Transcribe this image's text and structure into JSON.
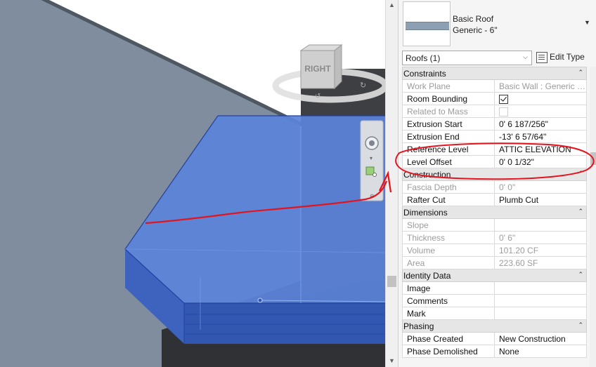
{
  "viewcube": {
    "face_label": "RIGHT"
  },
  "type_selector": {
    "family_name": "Basic Roof",
    "type_name": "Generic - 6\"",
    "dropdown_icon": "triangle-down-icon"
  },
  "instance_filter": {
    "value": "Roofs (1)",
    "edit_type_label": "Edit Type"
  },
  "properties": [
    {
      "group": "Constraints",
      "rows": [
        {
          "name": "Work Plane",
          "value": "Basic Wall : Generic - ...",
          "readonly": true
        },
        {
          "name": "Room Bounding",
          "value": "",
          "checkbox": true,
          "checked": true
        },
        {
          "name": "Related to Mass",
          "value": "",
          "checkbox": true,
          "checked": false,
          "readonly": true
        },
        {
          "name": "Extrusion Start",
          "value": "0'  6 187/256\""
        },
        {
          "name": "Extrusion End",
          "value": "-13'  6 57/64\""
        },
        {
          "name": "Reference Level",
          "value": "ATTIC ELEVATION"
        },
        {
          "name": "Level Offset",
          "value": "0'  0 1/32\""
        }
      ]
    },
    {
      "group": "Construction",
      "rows": [
        {
          "name": "Fascia Depth",
          "value": "0'  0\"",
          "readonly": true
        },
        {
          "name": "Rafter Cut",
          "value": "Plumb Cut"
        }
      ]
    },
    {
      "group": "Dimensions",
      "rows": [
        {
          "name": "Slope",
          "value": "",
          "readonly": true
        },
        {
          "name": "Thickness",
          "value": "0'  6\"",
          "readonly": true
        },
        {
          "name": "Volume",
          "value": "101.20 CF",
          "readonly": true
        },
        {
          "name": "Area",
          "value": "223.60 SF",
          "readonly": true
        }
      ]
    },
    {
      "group": "Identity Data",
      "rows": [
        {
          "name": "Image",
          "value": ""
        },
        {
          "name": "Comments",
          "value": ""
        },
        {
          "name": "Mark",
          "value": ""
        }
      ]
    },
    {
      "group": "Phasing",
      "rows": [
        {
          "name": "Phase Created",
          "value": "New Construction"
        },
        {
          "name": "Phase Demolished",
          "value": "None"
        }
      ]
    }
  ],
  "colors": {
    "wall_gray": "#7d8b9c",
    "roof_selected_blue": "#4a74d4",
    "annotation_red": "#e3141e",
    "category_header": "#e6e6e6"
  }
}
